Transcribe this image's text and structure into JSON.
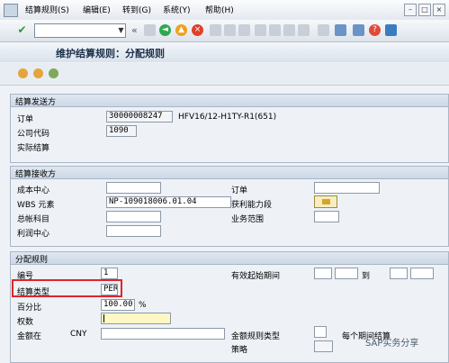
{
  "menu": [
    "结算规则(S)",
    "编辑(E)",
    "转到(G)",
    "系统(Y)",
    "帮助(H)"
  ],
  "toolbar": {
    "back": "«"
  },
  "title": "维护结算规则：分配规则",
  "sender": {
    "header": "结算发送方",
    "order_label": "订单",
    "order_value": "30000008247",
    "order_desc": "HFV16/12-H1TY-R1(651)",
    "company_label": "公司代码",
    "company_value": "1090",
    "actual_label": "实际结算"
  },
  "receiver": {
    "header": "结算接收方",
    "cost_center": "成本中心",
    "wbs_label": "WBS 元素",
    "wbs_value": "NP-109018006.01.04",
    "gl_account": "总帐科目",
    "profit_center": "利润中心",
    "order": "订单",
    "profit_segment": "获利能力段",
    "business_area": "业务范围"
  },
  "distribution": {
    "header": "分配规则",
    "number_label": "编号",
    "number_value": "1",
    "settle_type_label": "结算类型",
    "settle_type_value": "PER",
    "percent_label": "百分比",
    "percent_value": "100.00",
    "percent_unit": "%",
    "equiv_label": "权数",
    "amount_label": "金额在",
    "currency": "CNY",
    "valid_from": "有效起始期间",
    "to_label": "到",
    "amount_rule_type": "金额规则类型",
    "per_period": "每个期间结算",
    "strategy": "策略"
  },
  "watermark": "SAP实务分享"
}
